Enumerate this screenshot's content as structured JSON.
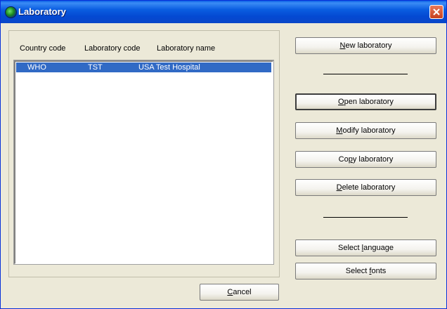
{
  "window": {
    "title": "Laboratory"
  },
  "list": {
    "columns": [
      "Country code",
      "Laboratory code",
      "Laboratory name"
    ],
    "rows": [
      {
        "country": "WHO",
        "code": "TST",
        "name": "USA Test Hospital"
      }
    ]
  },
  "buttons": {
    "new": {
      "pre": "",
      "key": "N",
      "post": "ew laboratory"
    },
    "open": {
      "pre": "",
      "key": "O",
      "post": "pen laboratory"
    },
    "modify": {
      "pre": "",
      "key": "M",
      "post": "odify laboratory"
    },
    "copy": {
      "pre": "Co",
      "key": "p",
      "post": "y laboratory"
    },
    "delete": {
      "pre": "",
      "key": "D",
      "post": "elete laboratory"
    },
    "language": {
      "pre": "Select ",
      "key": "l",
      "post": "anguage"
    },
    "fonts": {
      "pre": "Select ",
      "key": "f",
      "post": "onts"
    },
    "cancel": {
      "pre": "",
      "key": "C",
      "post": "ancel"
    }
  },
  "colors": {
    "titlebar": "#0a5de0",
    "selection": "#316ac5",
    "face": "#ece9d8"
  },
  "icons": {
    "app": "globe-icon",
    "close": "close-icon"
  }
}
